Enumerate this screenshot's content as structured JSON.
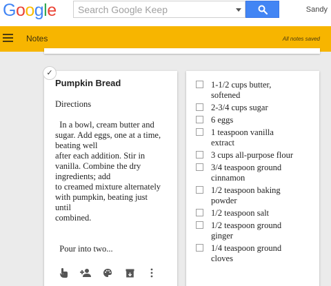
{
  "header": {
    "logo_letters": [
      "G",
      "o",
      "o",
      "g",
      "l",
      "e"
    ],
    "logo_colors": [
      "#4285f4",
      "#ea4335",
      "#fbbc05",
      "#4285f4",
      "#34a853",
      "#ea4335"
    ],
    "search_placeholder": "Search Google Keep",
    "search_icon": "search-icon",
    "user_name": "Sandy"
  },
  "appbar": {
    "menu_icon": "hamburger-menu-icon",
    "title": "Notes",
    "status": "All notes saved",
    "color": "#f7b500"
  },
  "note": {
    "title": "Pumpkin Bread",
    "lines": [
      "Directions",
      "",
      "  In a bowl, cream butter and",
      "sugar. Add eggs, one at a time,",
      "beating well",
      "after each addition. Stir in",
      "vanilla. Combine the dry",
      "ingredients; add",
      "to creamed mixture alternately",
      "with pumpkin, beating just",
      "until",
      "combined.",
      "",
      "",
      "  Pour into two..."
    ],
    "select_check": "✓",
    "actions": [
      "reminder-icon",
      "collaborator-icon",
      "palette-icon",
      "archive-icon",
      "more-icon"
    ]
  },
  "checklist": {
    "items": [
      [
        "1-1/2 cups butter,",
        "softened"
      ],
      [
        "2-3/4 cups sugar"
      ],
      [
        "6 eggs"
      ],
      [
        "1 teaspoon vanilla",
        "extract"
      ],
      [
        "3 cups all-purpose flour"
      ],
      [
        "3/4 teaspoon ground",
        "cinnamon"
      ],
      [
        "1/2 teaspoon baking",
        "powder"
      ],
      [
        "1/2 teaspoon salt"
      ],
      [
        "1/2 teaspoon ground",
        "ginger"
      ],
      [
        "1/4 teaspoon ground",
        "cloves"
      ]
    ]
  }
}
